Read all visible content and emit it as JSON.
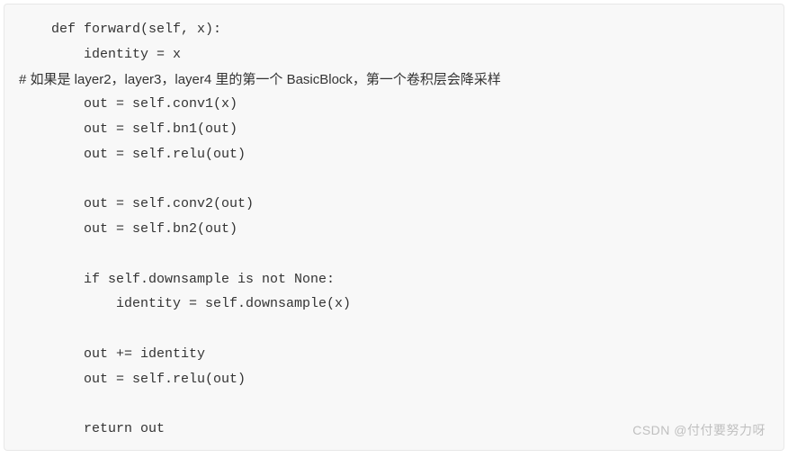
{
  "code": {
    "lines": [
      "    def forward(self, x):",
      "        identity = x",
      "# 如果是 layer2，layer3，layer4 里的第一个 BasicBlock，第一个卷积层会降采样",
      "        out = self.conv1(x)",
      "        out = self.bn1(out)",
      "        out = self.relu(out)",
      "",
      "        out = self.conv2(out)",
      "        out = self.bn2(out)",
      "",
      "        if self.downsample is not None:",
      "            identity = self.downsample(x)",
      "",
      "        out += identity",
      "        out = self.relu(out)",
      "",
      "        return out"
    ]
  },
  "watermark": "CSDN @付付要努力呀"
}
